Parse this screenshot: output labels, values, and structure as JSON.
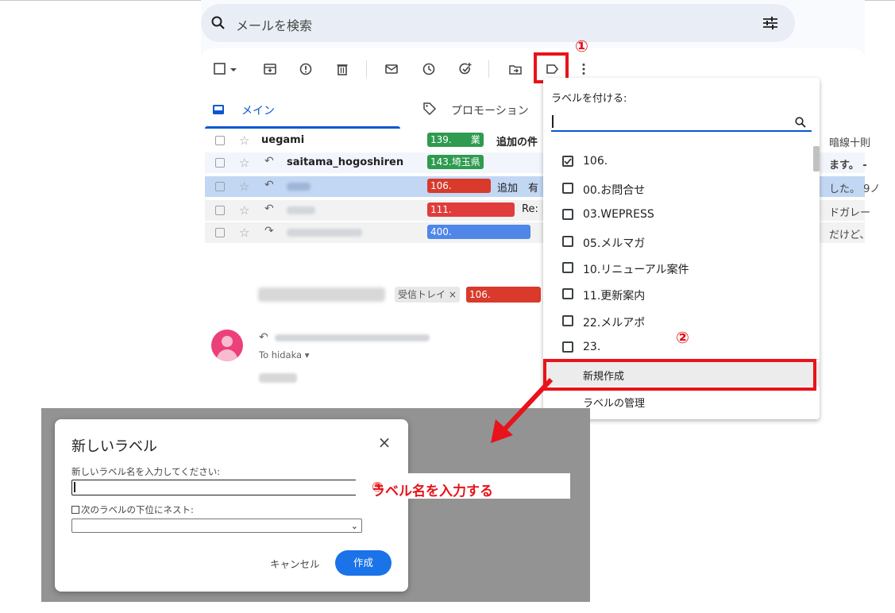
{
  "search": {
    "placeholder": "メールを検索"
  },
  "annotations": {
    "step1": "①",
    "step2": "②",
    "step3": "③",
    "step3_text": "ラベル名を入力する"
  },
  "tabs": {
    "main": "メイン",
    "promotions": "プロモーション"
  },
  "emails": [
    {
      "sender": "uegami",
      "label": "139.　　業",
      "label_color": "#2e9b4f",
      "subject": "追加の件",
      "tail": "暗線十則"
    },
    {
      "sender": "saitama_hogoshiren",
      "label": "143.埼玉県",
      "label_color": "#2e9b4f",
      "subject": "",
      "tail": "ます。 -"
    },
    {
      "sender": "",
      "label": "106.",
      "label_color": "#d93a2b",
      "subject": "追加　有",
      "tail": "した。 9ノ"
    },
    {
      "sender": "",
      "label": "111.",
      "label_color": "#e03c3c",
      "subject": "Re:",
      "tail": "ドガレー"
    },
    {
      "sender": "",
      "label": "400.",
      "label_color": "#4f86e8",
      "subject": "",
      "tail": "だけど、"
    }
  ],
  "opened": {
    "chip_inbox": "受信トレイ ×",
    "chip_label": "106.",
    "to_line": "To hidaka ▾"
  },
  "dropdown": {
    "title": "ラベルを付ける:",
    "items": [
      {
        "label": "106.",
        "checked": true
      },
      {
        "label": "00.お問合せ",
        "checked": false
      },
      {
        "label": "03.WEPRESS",
        "checked": false
      },
      {
        "label": "05.メルマガ",
        "checked": false
      },
      {
        "label": "10.リニューアル案件",
        "checked": false
      },
      {
        "label": "11.更新案内",
        "checked": false
      },
      {
        "label": "22.メルアポ",
        "checked": false
      },
      {
        "label": "23.",
        "checked": false
      }
    ],
    "create_new": "新規作成",
    "manage": "ラベルの管理"
  },
  "dialog": {
    "title": "新しいラベル",
    "close": "×",
    "name_label": "新しいラベル名を入力してください:",
    "nest_label": "次のラベルの下位にネスト:",
    "cancel": "キャンセル",
    "create": "作成"
  },
  "colors": {
    "accent": "#0b57d0",
    "highlight": "#e8131b",
    "create_button": "#1a73e8"
  }
}
